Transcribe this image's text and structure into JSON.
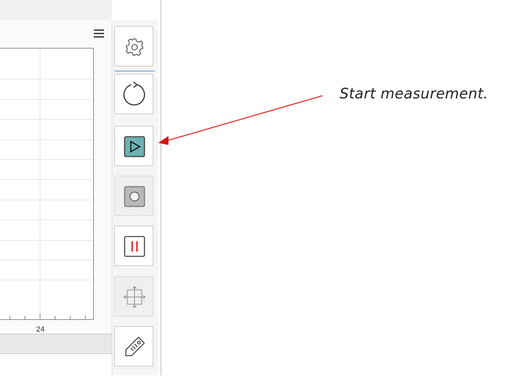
{
  "chart": {
    "x_tick_labels": [
      "24"
    ],
    "menu_icon": "hamburger-menu-icon"
  },
  "toolbar": {
    "buttons": [
      {
        "name": "settings",
        "icon": "gear-icon",
        "enabled": true
      },
      {
        "name": "refresh",
        "icon": "refresh-icon",
        "enabled": true
      },
      {
        "name": "start",
        "icon": "play-icon",
        "enabled": true,
        "accent": "#6db3b3"
      },
      {
        "name": "record",
        "icon": "record-icon",
        "enabled": false
      },
      {
        "name": "pause",
        "icon": "pause-icon",
        "enabled": true,
        "accent": "#e02020"
      },
      {
        "name": "fit-view",
        "icon": "move-arrows-icon",
        "enabled": false
      },
      {
        "name": "label",
        "icon": "tag-icon",
        "enabled": true
      }
    ]
  },
  "annotation": {
    "text": "Start measurement.",
    "arrow_color": "#e01010"
  }
}
